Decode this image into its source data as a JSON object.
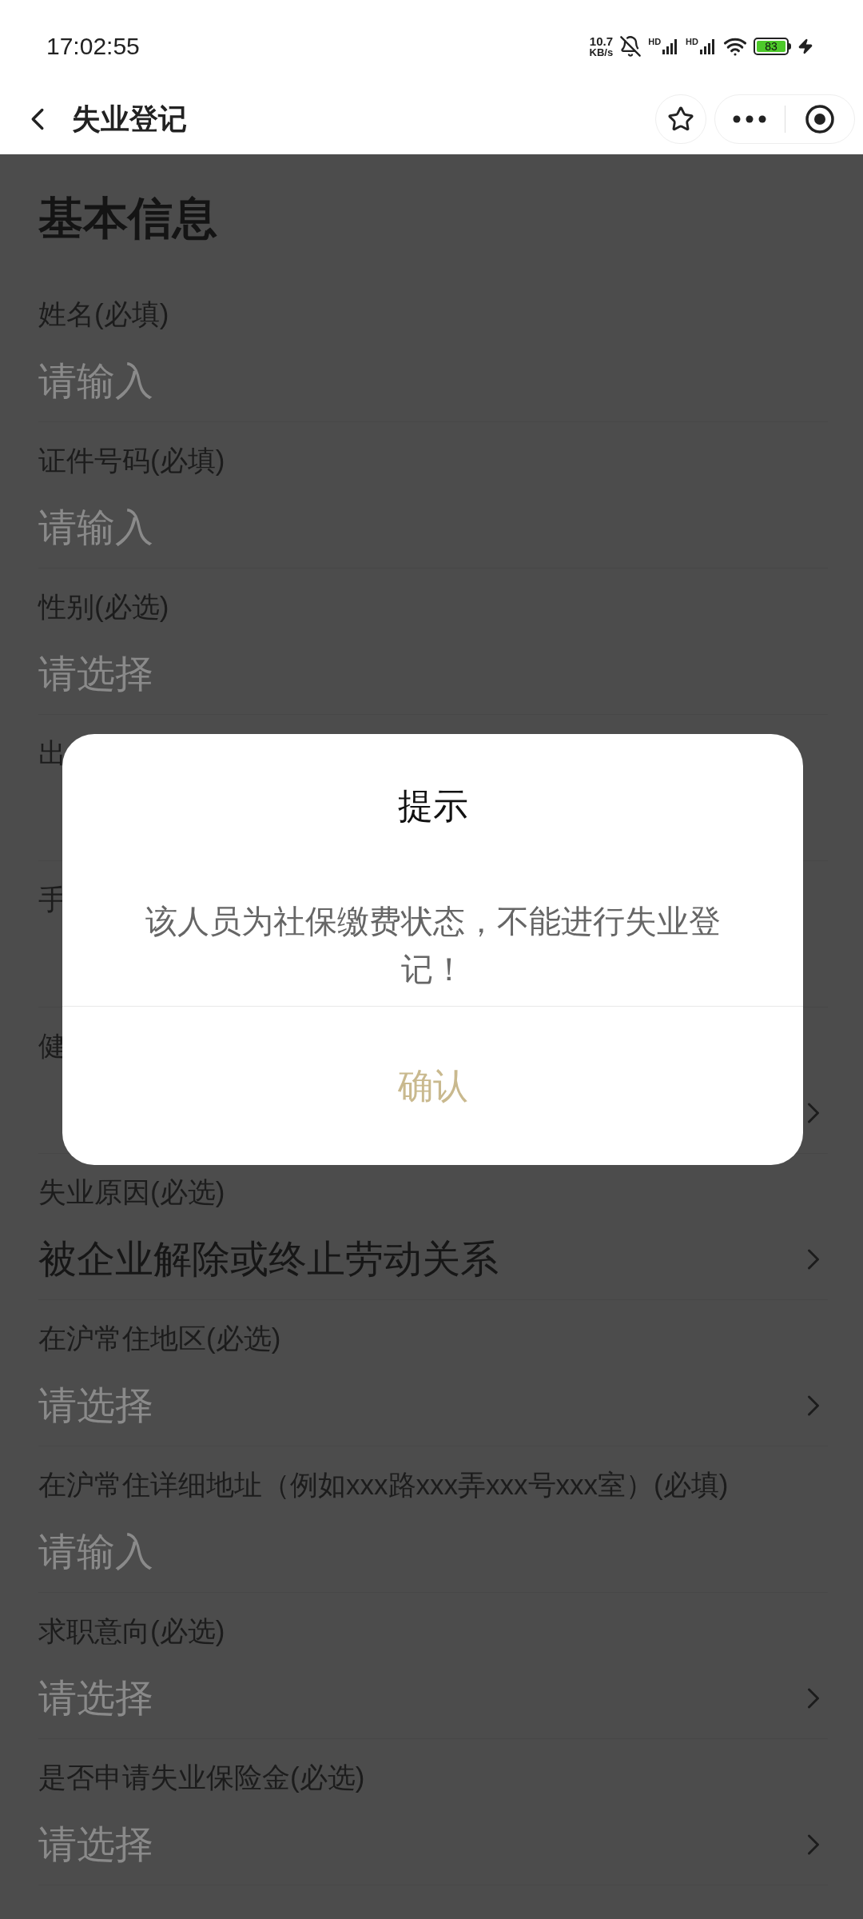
{
  "status_bar": {
    "time": "17:02:55",
    "net_speed": "10.7",
    "net_unit": "KB/s",
    "signal_labels": [
      "HD",
      "HD"
    ],
    "battery": "83"
  },
  "nav": {
    "title": "失业登记"
  },
  "section_title": "基本信息",
  "fields": [
    {
      "label": "姓名(必填)",
      "kind": "input",
      "placeholder": "请输入"
    },
    {
      "label": "证件号码(必填)",
      "kind": "input",
      "placeholder": "请输入"
    },
    {
      "label": "性别(必选)",
      "kind": "input",
      "placeholder": "请选择"
    },
    {
      "label": "出",
      "kind": "input"
    },
    {
      "label": "手",
      "kind": "input"
    },
    {
      "label": "健",
      "kind": "select"
    },
    {
      "label": "失业原因(必选)",
      "kind": "select",
      "value": "被企业解除或终止劳动关系"
    },
    {
      "label": "在沪常住地区(必选)",
      "kind": "select",
      "placeholder": "请选择"
    },
    {
      "label": "在沪常住详细地址（例如xxx路xxx弄xxx号xxx室）(必填)",
      "kind": "input",
      "placeholder": "请输入"
    },
    {
      "label": "求职意向(必选)",
      "kind": "select",
      "placeholder": "请选择"
    },
    {
      "label": "是否申请失业保险金(必选)",
      "kind": "select",
      "placeholder": "请选择"
    }
  ],
  "dialog": {
    "title": "提示",
    "message": "该人员为社保缴费状态，不能进行失业登记！",
    "button": "确认"
  }
}
